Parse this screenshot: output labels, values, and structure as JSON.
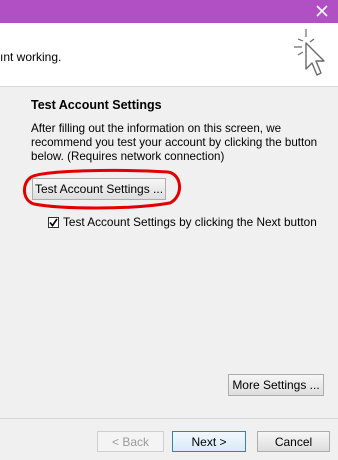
{
  "header": {
    "text": "ınt working."
  },
  "test_section": {
    "title": "Test Account Settings",
    "description": "After filling out the information on this screen, we recommend you test your account by clicking the button below. (Requires network connection)",
    "test_button_label": "Test Account Settings ...",
    "checkbox_label": "Test Account Settings by clicking the Next button",
    "checkbox_checked": true
  },
  "buttons": {
    "more_settings": "More Settings ...",
    "back": "< Back",
    "next": "Next >",
    "cancel": "Cancel"
  },
  "colors": {
    "titlebar": "#b14fc5",
    "highlight": "#e00000"
  },
  "icons": [
    "close-icon",
    "wizard-pointer-icon",
    "checkmark-icon"
  ]
}
